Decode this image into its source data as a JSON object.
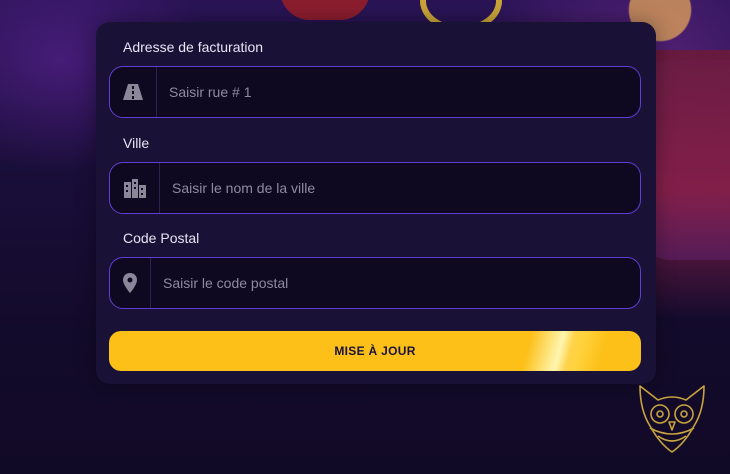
{
  "form": {
    "billing": {
      "label": "Adresse de facturation",
      "placeholder": "Saisir rue # 1",
      "icon": "road-icon"
    },
    "city": {
      "label": "Ville",
      "placeholder": "Saisir le nom de la ville",
      "icon": "city-icon"
    },
    "postal": {
      "label": "Code Postal",
      "placeholder": "Saisir le code postal",
      "icon": "map-pin-icon"
    },
    "submit_label": "MISE À JOUR"
  },
  "colors": {
    "accent": "#fcc019",
    "field_border": "#5d3fd3",
    "card_bg": "#1a1236",
    "page_bg": "#140c2c"
  }
}
